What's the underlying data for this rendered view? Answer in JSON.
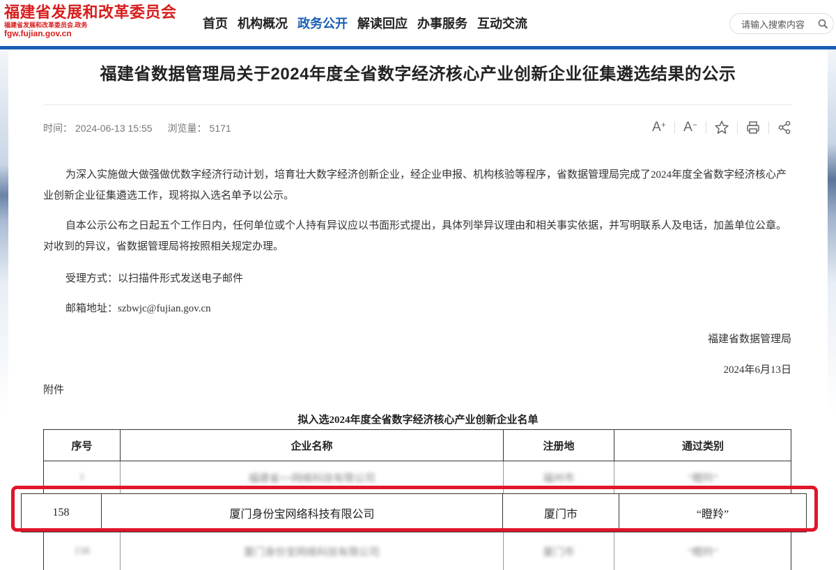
{
  "header": {
    "logo_name": "福建省发展和改革委员会",
    "logo_sub": "福建省发展和改革委员会.政务",
    "logo_domain": "fgw.fujian.gov.cn",
    "nav": [
      "首页",
      "机构概况",
      "政务公开",
      "解读回应",
      "办事服务",
      "互动交流"
    ],
    "active_nav": "政务公开",
    "search_placeholder": "请输入搜索内容",
    "accent_color": "#1a5eb3",
    "logo_color": "#d81e1e"
  },
  "article": {
    "title": "福建省数据管理局关于2024年度全省数字经济核心产业创新企业征集遴选结果的公示",
    "time_label": "时间：",
    "time_value": "2024-06-13 15:55",
    "views_label": "浏览量：",
    "views_value": "5171",
    "tools": [
      "font-increase-icon",
      "font-decrease-icon",
      "star-icon",
      "print-icon",
      "share-icon"
    ],
    "paragraph1": "为深入实施做大做强做优数字经济行动计划，培育壮大数字经济创新企业，经企业申报、机构核验等程序，省数据管理局完成了2024年度全省数字经济核心产业创新企业征集遴选工作，现将拟入选名单予以公示。",
    "paragraph2": "自本公示公布之日起五个工作日内，任何单位或个人持有异议应以书面形式提出，具体列举异议理由和相关事实依据，并写明联系人及电话，加盖单位公章。对收到的异议，省数据管理局将按照相关规定办理。",
    "method": "受理方式：以扫描件形式发送电子邮件",
    "email": "邮箱地址：szbwjc@fujian.gov.cn",
    "signature": "福建省数据管理局",
    "date": "2024年6月13日",
    "attachment_label": "附件"
  },
  "table": {
    "caption": "拟入选2024年度全省数字经济核心产业创新企业名单",
    "headers": [
      "序号",
      "企业名称",
      "注册地",
      "通过类别"
    ],
    "blurred_above": [
      "1",
      "福建省××网络科技有限公司",
      "福州市",
      "“瞪羚”"
    ],
    "highlighted": [
      "158",
      "厦门身份宝网络科技有限公司",
      "厦门市",
      "“瞪羚”"
    ],
    "blurred_below": [
      "158",
      "厦门身份宝网络科技有限公司",
      "厦门市",
      "“瞪羚”"
    ],
    "highlight_color": "#e0162b"
  }
}
